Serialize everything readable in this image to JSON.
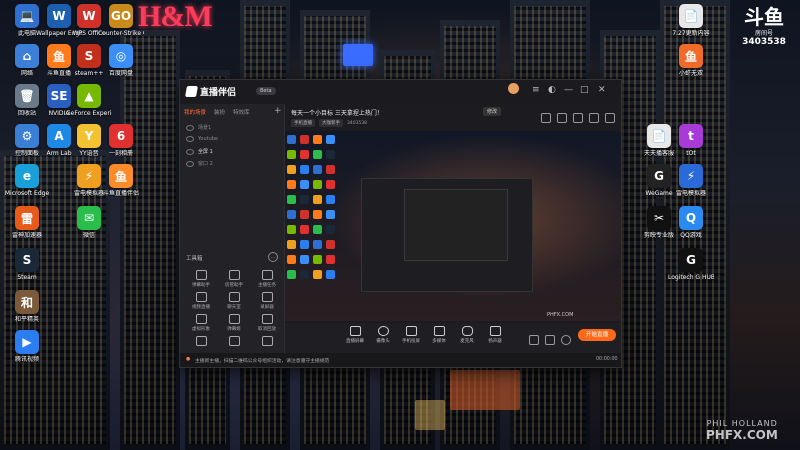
{
  "desktop": {
    "brand_sign": "H&M",
    "left_icons": [
      {
        "label": "此电脑",
        "glyph": "💻",
        "color": "#2f6fd0"
      },
      {
        "label": "Wallpaper Engine",
        "glyph": "W",
        "color": "#1b5fae"
      },
      {
        "label": "WPS Office",
        "glyph": "W",
        "color": "#d0322b"
      },
      {
        "label": "Counter-Strike Global Off...",
        "glyph": "GO",
        "color": "#c88a1a"
      },
      {
        "label": "网络",
        "glyph": "⌂",
        "color": "#3b7fd8"
      },
      {
        "label": "斗鱼直播",
        "glyph": "鱼",
        "color": "#ff7a1a"
      },
      {
        "label": "steam++",
        "glyph": "S",
        "color": "#c2301d"
      },
      {
        "label": "百度网盘",
        "glyph": "◎",
        "color": "#3a8ef6"
      },
      {
        "label": "回收站",
        "glyph": "🗑",
        "color": "#6b7a8a"
      },
      {
        "label": "NVIDIA",
        "glyph": "SE",
        "color": "#2b5fbf"
      },
      {
        "label": "GeForce Experience",
        "glyph": "▲",
        "color": "#76b900"
      },
      {
        "label": "控制面板",
        "glyph": "⚙",
        "color": "#3a7fd4"
      },
      {
        "label": "Arm Lab",
        "glyph": "A",
        "color": "#1e88e5"
      },
      {
        "label": "YY语音",
        "glyph": "Y",
        "color": "#f2c230"
      },
      {
        "label": "一刻相册",
        "glyph": "6",
        "color": "#e03030"
      },
      {
        "label": "Microsoft Edge",
        "glyph": "e",
        "color": "#1aa0d8"
      },
      {
        "label": "雷电模拟器",
        "glyph": "⚡",
        "color": "#f0a020"
      },
      {
        "label": "斗鱼直播伴侣",
        "glyph": "鱼",
        "color": "#ff8a2a"
      },
      {
        "label": "雷神加速器",
        "glyph": "雷",
        "color": "#e65a1a"
      },
      {
        "label": "微信",
        "glyph": "✉",
        "color": "#2bbd4b"
      },
      {
        "label": "Steam",
        "glyph": "S",
        "color": "#1b2838"
      },
      {
        "label": "和平精英",
        "glyph": "和",
        "color": "#7a5a3a"
      },
      {
        "label": "腾讯视频",
        "glyph": "▶",
        "color": "#2a7ef0"
      }
    ],
    "right_icons": [
      {
        "label": "7.27更新内容",
        "glyph": "📄",
        "color": "#e8e8e8"
      },
      {
        "label": "小虾无双",
        "glyph": "鱼",
        "color": "#f06a2a"
      },
      {
        "label": "天天播客服",
        "glyph": "📄",
        "color": "#e8e8e8"
      },
      {
        "label": "tOt",
        "glyph": "t",
        "color": "#a83ad8"
      },
      {
        "label": "WeGame",
        "glyph": "G",
        "color": "#222"
      },
      {
        "label": "雷电模拟器",
        "glyph": "⚡",
        "color": "#2a6ad8"
      },
      {
        "label": "剪映专业版",
        "glyph": "✂",
        "color": "#111"
      },
      {
        "label": "QQ游戏",
        "glyph": "Q",
        "color": "#2a8af0"
      },
      {
        "label": "Logitech G HUB",
        "glyph": "G",
        "color": "#111"
      }
    ]
  },
  "watermark_top": {
    "logo": "斗鱼",
    "sub": "房间号",
    "room": "3403538"
  },
  "watermark_bottom": {
    "author": "PHIL HOLLAND",
    "site": "PHFX.COM"
  },
  "app": {
    "title": "直播伴侣",
    "version_badge": "Beta",
    "tabs": [
      "我的场景",
      "装扮",
      "特效库"
    ],
    "scenes": [
      "场景1",
      "Youtube",
      "全屏 1",
      "窗口 2"
    ],
    "tools_header": "工具箱",
    "tools": [
      "弹幕助手",
      "房管助手",
      "主播任务",
      "视频直播",
      "聊天室",
      "录屏器",
      "虚拟形象",
      "弹幕姬",
      "取消回放",
      "",
      "",
      ""
    ],
    "stream_title": "每天一个小目标 三天拿捏上热门！",
    "edit_label": "修改",
    "meta_chips": [
      "手机直播",
      "大咖新手"
    ],
    "room_number": "3403538",
    "preview_watermark": "PHFX.COM",
    "bottom_tools": [
      "直播屏幕",
      "摄像头",
      "手机投屏",
      "多媒体",
      "麦克风",
      "扬声器"
    ],
    "go_live": "开始直播",
    "status_message": "主播新主播，扫描二维码公众号组织活动，请注意遵守主播规范",
    "status_time": "00:00:00"
  }
}
